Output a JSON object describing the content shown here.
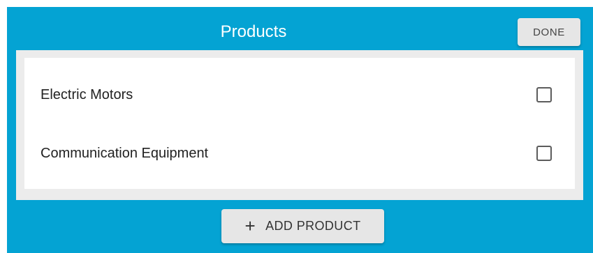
{
  "header": {
    "title": "Products",
    "done_label": "DONE"
  },
  "products": [
    {
      "name": "Electric Motors",
      "checked": false
    },
    {
      "name": "Communication Equipment",
      "checked": false
    }
  ],
  "footer": {
    "add_icon": "+",
    "add_label": "ADD PRODUCT"
  },
  "colors": {
    "panel_background": "#04a3d3",
    "button_background": "#e6e6e6",
    "list_background": "#ffffff"
  }
}
